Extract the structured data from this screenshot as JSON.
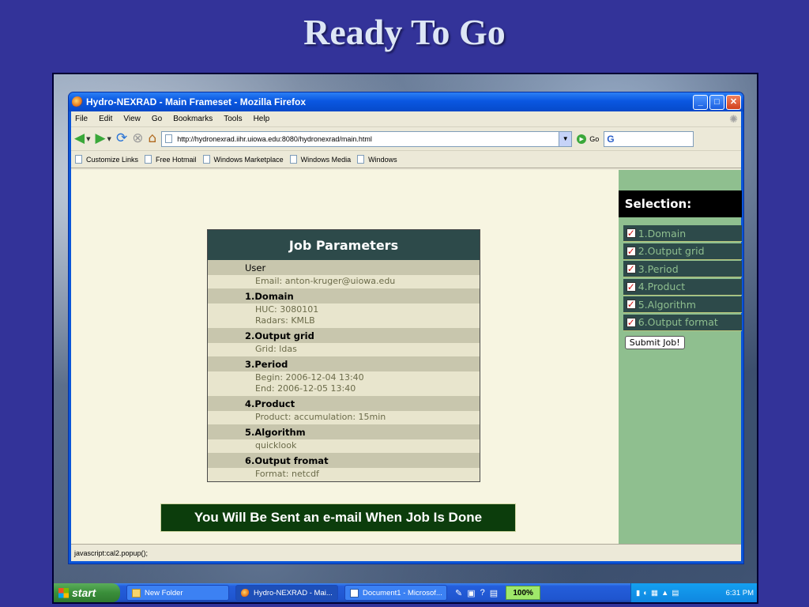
{
  "slide": {
    "title": "Ready To Go"
  },
  "browser": {
    "title": "Hydro-NEXRAD - Main Frameset - Mozilla Firefox",
    "window_buttons": {
      "minimize": "_",
      "maximize": "□",
      "close": "✕"
    },
    "menu": [
      "File",
      "Edit",
      "View",
      "Go",
      "Bookmarks",
      "Tools",
      "Help"
    ],
    "url": "http://hydronexrad.iihr.uiowa.edu:8080/hydronexrad/main.html",
    "go_label": "Go",
    "search_glyph": "G",
    "bookmarks": [
      "Customize Links",
      "Free Hotmail",
      "Windows Marketplace",
      "Windows Media",
      "Windows"
    ],
    "status": "javascript:cal2.popup();"
  },
  "job_parameters": {
    "header": "Job Parameters",
    "rows": [
      {
        "label": "User",
        "values": [
          "Email:  anton-kruger@uiowa.edu"
        ]
      },
      {
        "label": "1.Domain",
        "values": [
          "HUC:  3080101",
          "Radars:  KMLB"
        ]
      },
      {
        "label": "2.Output grid",
        "values": [
          "Grid:  ldas"
        ]
      },
      {
        "label": "3.Period",
        "values": [
          "Begin:  2006-12-04 13:40",
          "End:  2006-12-05 13:40"
        ]
      },
      {
        "label": "4.Product",
        "values": [
          "Product:  accumulation: 15min"
        ]
      },
      {
        "label": "5.Algorithm",
        "values": [
          "quicklook"
        ]
      },
      {
        "label": "6.Output fromat",
        "values": [
          "Format:  netcdf"
        ]
      }
    ]
  },
  "banner": {
    "text": "You Will Be Sent an e-mail When Job Is Done"
  },
  "selection": {
    "header": "Selection:",
    "items": [
      "1.Domain",
      "2.Output grid",
      "3.Period",
      "4.Product",
      "5.Algorithm",
      "6.Output format"
    ],
    "submit_label": "Submit Job!"
  },
  "taskbar": {
    "start_label": "start",
    "tasks": [
      "New Folder",
      "Hydro-NEXRAD - Mai...",
      "Document1 - Microsof..."
    ],
    "zoom": "100%",
    "clock": "6:31 PM"
  },
  "colors": {
    "slide_bg": "#333399",
    "job_header": "#2d4a4a",
    "sidebar_bg": "#8fbf8f",
    "banner_bg": "#0c3d0c"
  }
}
